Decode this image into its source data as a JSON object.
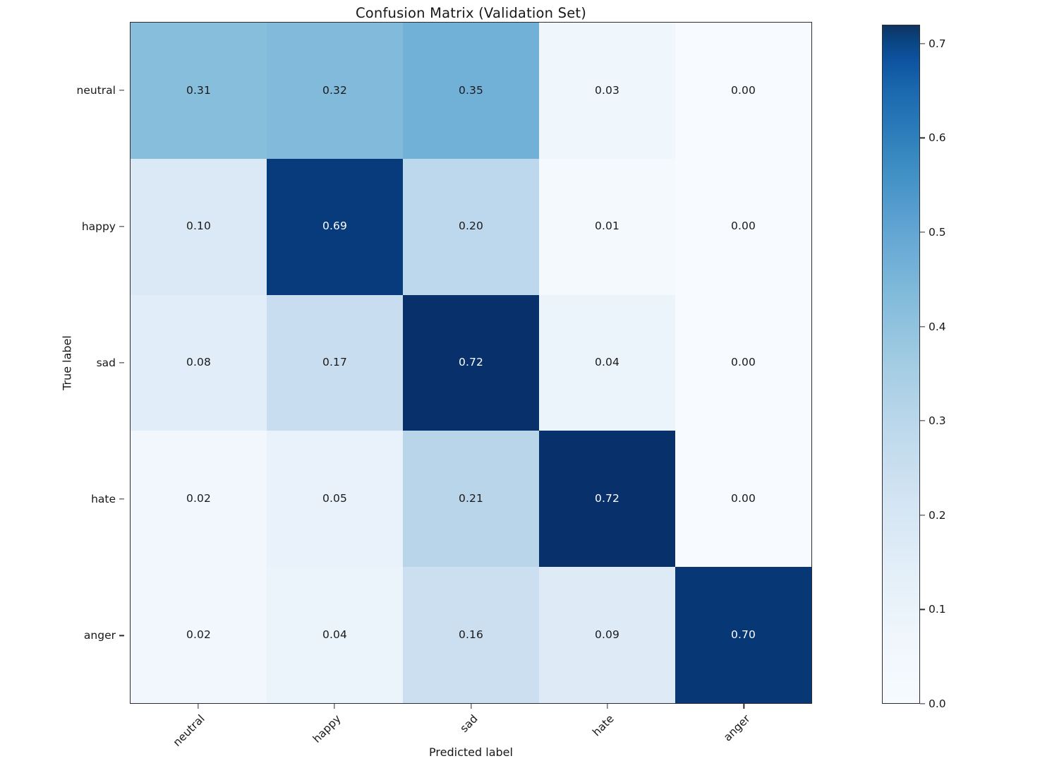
{
  "chart_data": {
    "type": "heatmap",
    "title": "Confusion Matrix (Validation Set)",
    "xlabel": "Predicted label",
    "ylabel": "True label",
    "categories": [
      "neutral",
      "happy",
      "sad",
      "hate",
      "anger"
    ],
    "x_ticklabels": [
      "neutral",
      "happy",
      "sad",
      "hate",
      "anger"
    ],
    "y_ticklabels": [
      "neutral",
      "happy",
      "sad",
      "hate",
      "anger"
    ],
    "rows": [
      {
        "label": "neutral",
        "values": [
          0.31,
          0.32,
          0.35,
          0.03,
          0.0
        ]
      },
      {
        "label": "happy",
        "values": [
          0.1,
          0.69,
          0.2,
          0.01,
          0.0
        ]
      },
      {
        "label": "sad",
        "values": [
          0.08,
          0.17,
          0.72,
          0.04,
          0.0
        ]
      },
      {
        "label": "hate",
        "values": [
          0.02,
          0.05,
          0.21,
          0.72,
          0.0
        ]
      },
      {
        "label": "anger",
        "values": [
          0.02,
          0.04,
          0.16,
          0.09,
          0.7
        ]
      }
    ],
    "cell_text": [
      [
        "0.31",
        "0.32",
        "0.35",
        "0.03",
        "0.00"
      ],
      [
        "0.10",
        "0.69",
        "0.20",
        "0.01",
        "0.00"
      ],
      [
        "0.08",
        "0.17",
        "0.72",
        "0.04",
        "0.00"
      ],
      [
        "0.02",
        "0.05",
        "0.21",
        "0.72",
        "0.00"
      ],
      [
        "0.02",
        "0.04",
        "0.16",
        "0.09",
        "0.70"
      ]
    ],
    "grid": false,
    "colormap": "Blues",
    "vmin": 0.0,
    "vmax": 0.72,
    "colorbar": {
      "position": "right",
      "tick_values": [
        0.0,
        0.1,
        0.2,
        0.3,
        0.4,
        0.5,
        0.6,
        0.7
      ],
      "tick_labels": [
        "0.0",
        "0.1",
        "0.2",
        "0.3",
        "0.4",
        "0.5",
        "0.6",
        "0.7"
      ]
    },
    "text_color_dark": "#1a1a1a",
    "text_color_light": "#ffffff",
    "axis_color": "#2b2b33",
    "background": "#ffffff"
  }
}
